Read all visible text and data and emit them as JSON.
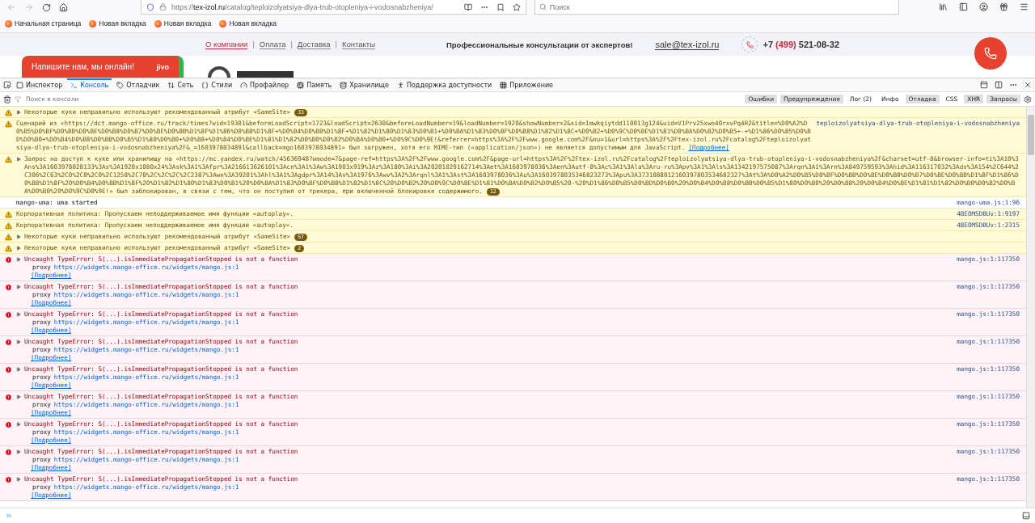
{
  "browser": {
    "url_scheme": "https://",
    "url_host": "tex-izol.ru",
    "url_path": "/catalog/teploizolyatsiya-dlya-trub-otopleniya-i-vodosnabzheniya/",
    "search_placeholder": "Поиск",
    "bookmarks": [
      "Начальная страница",
      "Новая вкладка",
      "Новая вкладка",
      "Новая вкладка"
    ]
  },
  "page": {
    "nav_separator": "|",
    "nav_links": [
      {
        "label": "О компании",
        "selected": true
      },
      {
        "label": "Оплата",
        "selected": false
      },
      {
        "label": "Доставка",
        "selected": false
      },
      {
        "label": "Контакты",
        "selected": false
      }
    ],
    "tagline": "Профессиональные консультации от экспертов!",
    "email": "sale@tex-izol.ru",
    "phone_prefix": "+7",
    "phone_code": "(499)",
    "phone_number": "521-08-32",
    "chat_text": "Напишите нам, мы онлайн!",
    "chat_brand": "jivo"
  },
  "devtools": {
    "tabs": [
      {
        "label": "Инспектор",
        "selected": false
      },
      {
        "label": "Консоль",
        "selected": true
      },
      {
        "label": "Отладчик",
        "selected": false
      },
      {
        "label": "Сеть",
        "selected": false
      },
      {
        "label": "Стили",
        "selected": false
      },
      {
        "label": "Профайлер",
        "selected": false
      },
      {
        "label": "Память",
        "selected": false
      },
      {
        "label": "Хранилище",
        "selected": false
      },
      {
        "label": "Поддержка доступности",
        "selected": false
      },
      {
        "label": "Приложение",
        "selected": false
      }
    ],
    "filter_placeholder": "Поиск в консоли",
    "filters": [
      {
        "label": "Ошибки",
        "selected": true
      },
      {
        "label": "Предупреждения",
        "selected": true
      },
      {
        "label": "Лог (2)",
        "selected": false
      },
      {
        "label": "Инфо",
        "selected": false
      },
      {
        "label": "Отладка",
        "selected": true
      },
      {
        "label": "CSS",
        "selected": false
      },
      {
        "label": "XHR",
        "selected": true
      },
      {
        "label": "Запросы",
        "selected": true
      }
    ],
    "messages": [
      {
        "kind": "warning",
        "expandable": true,
        "text": "Некоторые куки неправильно используют рекомендованный атрибут «SameSite»",
        "count": "33"
      },
      {
        "kind": "warning",
        "expandable": false,
        "text": "Сценарий из «https://dct.mango-office.ru/track/times?wid=19301&beforeLoadScript=1723&loadScript=2630&beforeLoadNumber=19&loadNumber=1920&showNumber=2&sid=1mwkqiytdd110013g124&uid=V1Prv25xwo40rxvPq4R2&title=%D0%A2%D0%B5%D0%BF%D0%BB%D0%BE%D0%B8%D0%B7%D0%BE%D0%BB%D1%8F%D1%86%D0%B8%D1%8F+%D0%B4%D0%BB%D1%8F+%D1%82%D1%80%D1%83%D0%B1+%D0%BA%D1%83%D0%BF%D0%B8%D1%82%D1%8C+%D0%B2+%D0%9C%D0%BE%D1%81%D0%BA%D0%B2%D0%B5+-+%D1%86%D0%B5%D0%BD%D0%B0+%D0%B4%D0%B8%D0%BB%D0%B5%D1%80%D0%B0+%D0%B8+%D0%B4%D0%BE%D1%81%D1%82%D0%B0%D0%B2%D0%BA%D0%B0+%D0%9C%D0%9E!&referrer=https%3A%2F%2Fwww.google.com%2F&nu=1&url=https%3A%2F%2Ftex-izol.ru%2Fcatalog%2Fteploizolyatsiya-dlya-trub-otopleniya-i-vodosnabzheniya%2F&_=1603978034891&callback=mgo1603978034891» был загружен, хотя его MIME-тип («application/json») не является допустимым для JavaScript.",
        "more": "[Подробнее]",
        "source": "teploizolyatsiya-dlya-trub-otopleniya-i-vodosnabzheniya"
      },
      {
        "kind": "warning",
        "expandable": true,
        "text": "Запрос на доступ к куке или хранилищу на «https://mc.yandex.ru/watch/45636948?wmode=7&page-ref=https%3A%2F%2Fwww.google.com%2F&page-url=https%3A%2F%2Ftex-izol.ru%2Fcatalog%2Fteploizolyatsiya-dlya-trub-otopleniya-i-vodosnabzheniya%2F&charset=utf-8&browser-info=ti%3A10%3Ans%3A1603978028133%3As%3A1920x1080x24%3Ask%3A1%3Afpr%3A216613626101%3Acn%3A1%3Aw%3A1903x919%3Az%3A180%3Ai%3A20201029162714%3Aet%3A1603978036%3Aen%3Autf-8%3Ac%3A1%3Ala%3Aru-ru%3Apv%3A1%3Als%3A1342197575087%3Arqn%3A1%3Arn%3A849759593%3Ahid%3A116317032%3Ads%3A154%2C644%2C306%2C63%2C0%2C0%2C0%2C1258%2C78%2C%2C%2C%2C2387%3Awn%3A39201%3Ahl%3A1%3Agdpr%3A14%3Av%3A1976%3Awv%3A2%3Arqnl%3A1%3Ast%3A1603978036%3Au%3A1603978035346823273%3Apu%3A3731088012160397803534682327%3At%3A%D0%A2%D0%B5%D0%BF%D0%BB%D0%BE%D0%B8%D0%B7%D0%BE%D0%BB%D1%8F%D1%86%D0%B8%D1%8F%20%D0%B4%D0%BB%D1%8F%20%D1%82%D1%80%D1%83%D0%B1%20%D0%BA%D1%83%D0%BF%D0%B8%D1%82%D1%8C%20%D0%B2%20%D0%9C%D0%BE%D1%81%D0%BA%D0%B2%D0%B5%20-%20%D1%86%D0%B5%D0%BD%D0%B0%20%D0%B4%D0%B8%D0%BB%D0%B5%D1%80%D0%B0%20%D0%B8%20%D0%B4%D0%BE%D1%81%D1%82%D0%B0%D0%B2%D0%BA%D0%B0%20%D0%9C%D0%9E!» был заблокирован, в связи с тем, что он поступил от трекера, при включенной блокировке содержимого.",
        "count": "12"
      },
      {
        "kind": "log",
        "expandable": false,
        "text": "mango-uma: uma started",
        "source": "mango-uma.js:1:96"
      },
      {
        "kind": "warning",
        "expandable": false,
        "text": "Корпоративная политика: Пропускаем неподдерживаемое имя функции «autoplay».",
        "source": "4BEOMSDBUv:1:9197"
      },
      {
        "kind": "warning",
        "expandable": false,
        "text": "Корпоративная политика: Пропускаем неподдерживаемое имя функции «autoplay».",
        "source": "4BEOMSDBUv:1:2315"
      },
      {
        "kind": "warning",
        "expandable": true,
        "text": "Некоторые куки неправильно используют рекомендованный атрибут «SameSite»",
        "count": "57"
      },
      {
        "kind": "warning",
        "expandable": true,
        "text": "Некоторые куки неправильно используют рекомендованный атрибут «SameSite»",
        "count": "2"
      },
      {
        "kind": "error",
        "expandable": true,
        "text": "Uncaught TypeError: S(...).isImmediatePropagationStopped is not a function",
        "detail": "proxy",
        "detail_url": "https://widgets.mango-office.ru/widgets/mango.js:1",
        "more": "[Подробнее]",
        "source": "mango.js:1:117350"
      },
      {
        "kind": "error",
        "expandable": true,
        "text": "Uncaught TypeError: S(...).isImmediatePropagationStopped is not a function",
        "detail": "proxy",
        "detail_url": "https://widgets.mango-office.ru/widgets/mango.js:1",
        "more": "[Подробнее]",
        "source": "mango.js:1:117350"
      },
      {
        "kind": "error",
        "expandable": true,
        "text": "Uncaught TypeError: S(...).isImmediatePropagationStopped is not a function",
        "detail": "proxy",
        "detail_url": "https://widgets.mango-office.ru/widgets/mango.js:1",
        "more": "[Подробнее]",
        "source": "mango.js:1:117350"
      },
      {
        "kind": "error",
        "expandable": true,
        "text": "Uncaught TypeError: S(...).isImmediatePropagationStopped is not a function",
        "detail": "proxy",
        "detail_url": "https://widgets.mango-office.ru/widgets/mango.js:1",
        "more": "[Подробнее]",
        "source": "mango.js:1:117350"
      },
      {
        "kind": "error",
        "expandable": true,
        "text": "Uncaught TypeError: S(...).isImmediatePropagationStopped is not a function",
        "detail": "proxy",
        "detail_url": "https://widgets.mango-office.ru/widgets/mango.js:1",
        "more": "[Подробнее]",
        "source": "mango.js:1:117350"
      },
      {
        "kind": "error",
        "expandable": true,
        "text": "Uncaught TypeError: S(...).isImmediatePropagationStopped is not a function",
        "detail": "proxy",
        "detail_url": "https://widgets.mango-office.ru/widgets/mango.js:1",
        "more": "[Подробнее]",
        "source": "mango.js:1:117350"
      },
      {
        "kind": "error",
        "expandable": true,
        "text": "Uncaught TypeError: S(...).isImmediatePropagationStopped is not a function",
        "detail": "proxy",
        "detail_url": "https://widgets.mango-office.ru/widgets/mango.js:1",
        "more": "[Подробнее]",
        "source": "mango.js:1:117350"
      },
      {
        "kind": "error",
        "expandable": true,
        "text": "Uncaught TypeError: S(...).isImmediatePropagationStopped is not a function",
        "detail": "proxy",
        "detail_url": "https://widgets.mango-office.ru/widgets/mango.js:1",
        "more": "[Подробнее]",
        "source": "mango.js:1:117350"
      },
      {
        "kind": "error",
        "expandable": true,
        "text": "Uncaught TypeError: S(...).isImmediatePropagationStopped is not a function",
        "detail": "proxy",
        "detail_url": "https://widgets.mango-office.ru/widgets/mango.js:1",
        "more": "[Подробнее]",
        "source": "mango.js:1:117350"
      }
    ]
  }
}
